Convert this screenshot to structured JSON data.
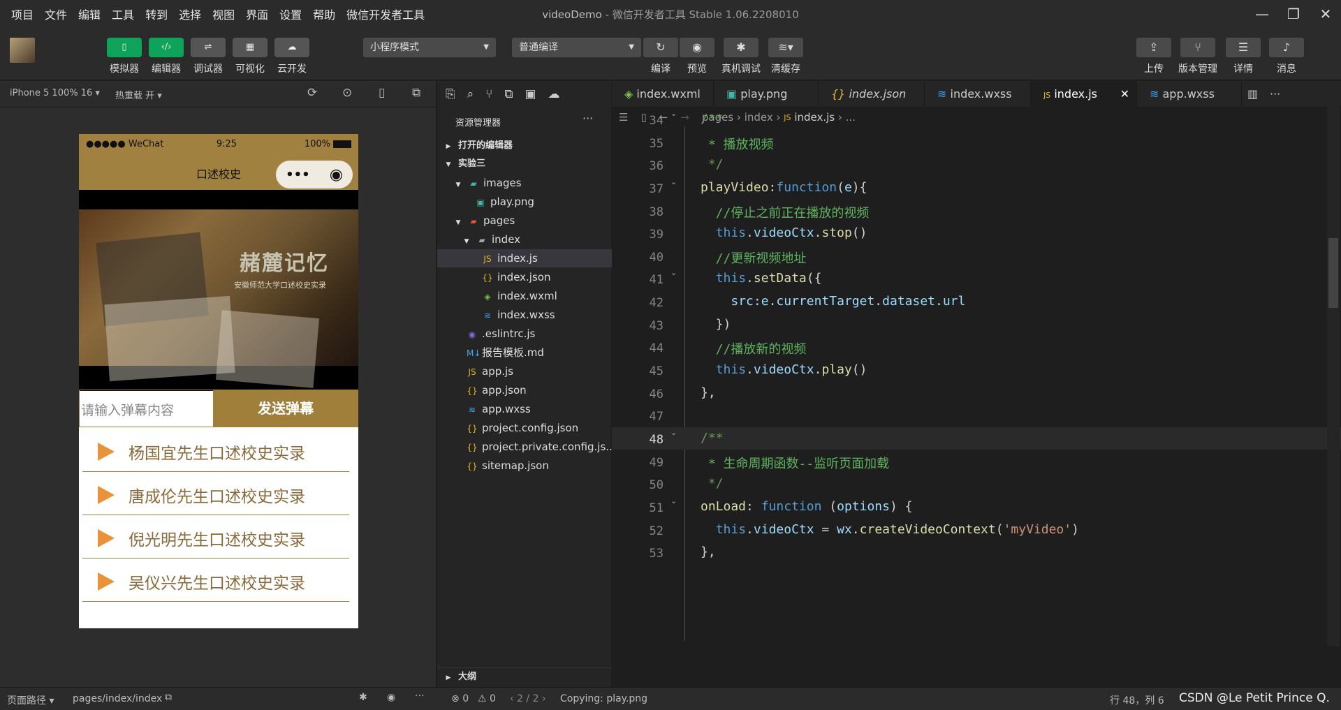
{
  "menu": [
    "项目",
    "文件",
    "编辑",
    "工具",
    "转到",
    "选择",
    "视图",
    "界面",
    "设置",
    "帮助",
    "微信开发者工具"
  ],
  "window": {
    "name": "videoDemo",
    "sep": " - ",
    "app": "微信开发者工具 Stable 1.06.2208010"
  },
  "toolbar": {
    "mode_buttons": [
      "模拟器",
      "编辑器",
      "调试器",
      "可视化",
      "云开发"
    ],
    "mode_select": "小程序模式",
    "compile_select": "普通编译",
    "actions": [
      "编译",
      "预览",
      "真机调试",
      "清缓存"
    ],
    "right_actions": [
      "上传",
      "版本管理",
      "详情",
      "消息"
    ]
  },
  "simbar": {
    "device": "iPhone 5 100% 16",
    "hotreload": "热重载 开"
  },
  "phone": {
    "status_left": "●●●●● WeChat",
    "status_time": "9:25",
    "status_batt": "100%",
    "nav_title": "口述校史",
    "video_title": "赭麓记忆",
    "video_sub": "安徽师范大学口述校史实录",
    "danmu_placeholder": "请输入弹幕内容",
    "danmu_button": "发送弹幕",
    "videos": [
      "杨国宜先生口述校史实录",
      "唐成伦先生口述校史实录",
      "倪光明先生口述校史实录",
      "吴仪兴先生口述校史实录"
    ]
  },
  "explorer": {
    "title": "资源管理器",
    "open_editors": "打开的编辑器",
    "project": "实验三",
    "outline": "大纲",
    "files": [
      {
        "name": "images",
        "icon": "folder-images-icon"
      },
      {
        "name": "play.png",
        "icon": "image-file-icon"
      },
      {
        "name": "pages",
        "icon": "folder-pages-icon"
      },
      {
        "name": "index",
        "icon": "folder-open-icon"
      },
      {
        "name": "index.js",
        "icon": "js-file-icon"
      },
      {
        "name": "index.json",
        "icon": "json-file-icon"
      },
      {
        "name": "index.wxml",
        "icon": "wxml-file-icon"
      },
      {
        "name": "index.wxss",
        "icon": "css-file-icon"
      },
      {
        "name": ".eslintrc.js",
        "icon": "eslint-file-icon"
      },
      {
        "name": "报告模板.md",
        "icon": "markdown-file-icon"
      },
      {
        "name": "app.js",
        "icon": "js-file-icon"
      },
      {
        "name": "app.json",
        "icon": "json-file-icon"
      },
      {
        "name": "app.wxss",
        "icon": "css-file-icon"
      },
      {
        "name": "project.config.json",
        "icon": "json-file-icon"
      },
      {
        "name": "project.private.config.js...",
        "icon": "json-file-icon"
      },
      {
        "name": "sitemap.json",
        "icon": "json-file-icon"
      }
    ]
  },
  "tabs": [
    "index.wxml",
    "play.png",
    "index.json",
    "index.wxss",
    "index.js",
    "app.wxss"
  ],
  "breadcrumb": [
    "pages",
    "index",
    "index.js",
    "..."
  ],
  "line_numbers": [
    "34",
    "35",
    "36",
    "37",
    "38",
    "39",
    "40",
    "41",
    "42",
    "43",
    "44",
    "45",
    "46",
    "47",
    "48",
    "49",
    "50",
    "51",
    "52",
    "53"
  ],
  "statusbar": {
    "path_label": "页面路径",
    "path": "pages/index/index",
    "errors": "0",
    "warnings": "0",
    "pos": "2 / 2",
    "copying": "Copying: play.png",
    "cursor": "行 48，列 6",
    "watermark": "CSDN @Le Petit Prince Q."
  }
}
